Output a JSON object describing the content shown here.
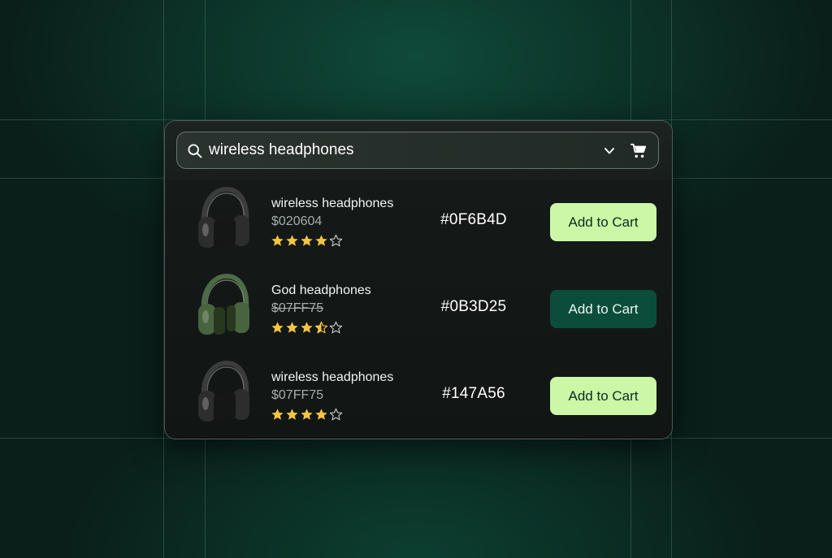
{
  "search": {
    "value": "wireless headphones"
  },
  "colors": {
    "accent_light": "#ccf7a6",
    "accent_dark": "#0b4d3b",
    "star": "#f5c542"
  },
  "icons": {
    "search": "search-icon",
    "dropdown": "chevron-down-icon",
    "cart": "cart-icon"
  },
  "products": [
    {
      "title": "wireless headphones",
      "price": "$020604",
      "price_struck": false,
      "rating": 4,
      "max_rating": 5,
      "hex": "#0F6B4D",
      "button_label": "Add to Cart",
      "button_style": "light",
      "headphone_color": "black"
    },
    {
      "title": "God headphones",
      "price": "$07FF75",
      "price_struck": true,
      "rating": 3.5,
      "max_rating": 5,
      "hex": "#0B3D25",
      "button_label": "Add to Cart",
      "button_style": "dark",
      "headphone_color": "olive-green"
    },
    {
      "title": "wireless headphones",
      "price": "$07FF75",
      "price_struck": false,
      "rating": 4,
      "max_rating": 5,
      "hex": "#147A56",
      "button_label": "Add to Cart",
      "button_style": "light",
      "headphone_color": "black"
    }
  ]
}
